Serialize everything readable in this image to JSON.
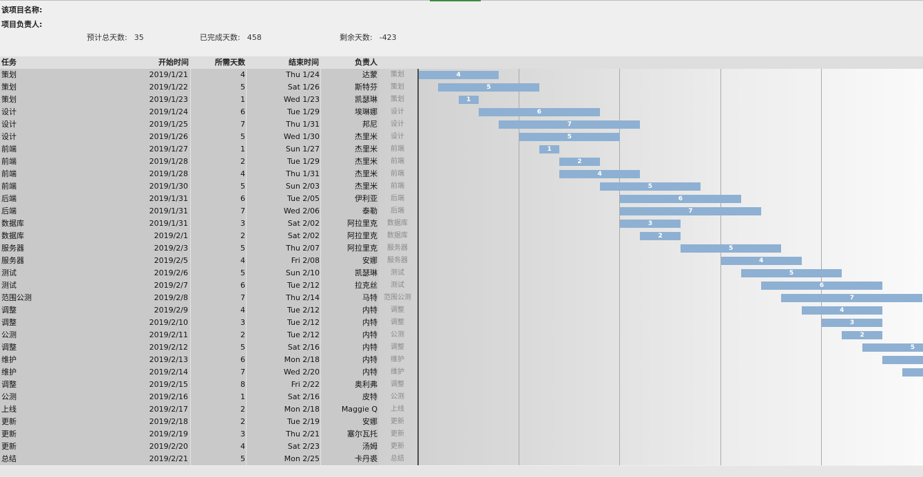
{
  "header": {
    "project_name_label": "该项目名称:",
    "project_owner_label": "项目负责人:",
    "estimated_total_label": "预计总天数:",
    "estimated_total_value": "35",
    "completed_label": "已完成天数:",
    "completed_value": "458",
    "remaining_label": "剩余天数:",
    "remaining_value": "-423"
  },
  "columns": {
    "task": "任务",
    "start": "开始时间",
    "days": "所需天数",
    "end": "结束时间",
    "owner": "负责人"
  },
  "rows": [
    {
      "task": "策划",
      "start": "2019/1/21",
      "days": "4",
      "end": "Thu 1/24",
      "owner": "达蒙",
      "offset": 0
    },
    {
      "task": "策划",
      "start": "2019/1/22",
      "days": "5",
      "end": "Sat 1/26",
      "owner": "斯特芬",
      "offset": 1
    },
    {
      "task": "策划",
      "start": "2019/1/23",
      "days": "1",
      "end": "Wed 1/23",
      "owner": "凯瑟琳",
      "offset": 2
    },
    {
      "task": "设计",
      "start": "2019/1/24",
      "days": "6",
      "end": "Tue 1/29",
      "owner": "埃琳娜",
      "offset": 3
    },
    {
      "task": "设计",
      "start": "2019/1/25",
      "days": "7",
      "end": "Thu 1/31",
      "owner": "邦尼",
      "offset": 4
    },
    {
      "task": "设计",
      "start": "2019/1/26",
      "days": "5",
      "end": "Wed 1/30",
      "owner": "杰里米",
      "offset": 5
    },
    {
      "task": "前端",
      "start": "2019/1/27",
      "days": "1",
      "end": "Sun 1/27",
      "owner": "杰里米",
      "offset": 6
    },
    {
      "task": "前端",
      "start": "2019/1/28",
      "days": "2",
      "end": "Tue 1/29",
      "owner": "杰里米",
      "offset": 7
    },
    {
      "task": "前端",
      "start": "2019/1/28",
      "days": "4",
      "end": "Thu 1/31",
      "owner": "杰里米",
      "offset": 7
    },
    {
      "task": "前端",
      "start": "2019/1/30",
      "days": "5",
      "end": "Sun 2/03",
      "owner": "杰里米",
      "offset": 9
    },
    {
      "task": "后端",
      "start": "2019/1/31",
      "days": "6",
      "end": "Tue 2/05",
      "owner": "伊利亚",
      "offset": 10
    },
    {
      "task": "后端",
      "start": "2019/1/31",
      "days": "7",
      "end": "Wed 2/06",
      "owner": "泰勒",
      "offset": 10
    },
    {
      "task": "数据库",
      "start": "2019/1/31",
      "days": "3",
      "end": "Sat 2/02",
      "owner": "阿拉里克",
      "offset": 10
    },
    {
      "task": "数据库",
      "start": "2019/2/1",
      "days": "2",
      "end": "Sat 2/02",
      "owner": "阿拉里克",
      "offset": 11
    },
    {
      "task": "服务器",
      "start": "2019/2/3",
      "days": "5",
      "end": "Thu 2/07",
      "owner": "阿拉里克",
      "offset": 13
    },
    {
      "task": "服务器",
      "start": "2019/2/5",
      "days": "4",
      "end": "Fri 2/08",
      "owner": "安娜",
      "offset": 15
    },
    {
      "task": "测试",
      "start": "2019/2/6",
      "days": "5",
      "end": "Sun 2/10",
      "owner": "凯瑟琳",
      "offset": 16
    },
    {
      "task": "测试",
      "start": "2019/2/7",
      "days": "6",
      "end": "Tue 2/12",
      "owner": "拉克丝",
      "offset": 17
    },
    {
      "task": "范围公测",
      "start": "2019/2/8",
      "days": "7",
      "end": "Thu 2/14",
      "owner": "马特",
      "offset": 18
    },
    {
      "task": "调整",
      "start": "2019/2/9",
      "days": "4",
      "end": "Tue 2/12",
      "owner": "内特",
      "offset": 19
    },
    {
      "task": "调整",
      "start": "2019/2/10",
      "days": "3",
      "end": "Tue 2/12",
      "owner": "内特",
      "offset": 20
    },
    {
      "task": "公测",
      "start": "2019/2/11",
      "days": "2",
      "end": "Tue 2/12",
      "owner": "内特",
      "offset": 21
    },
    {
      "task": "调整",
      "start": "2019/2/12",
      "days": "5",
      "end": "Sat 2/16",
      "owner": "内特",
      "offset": 22
    },
    {
      "task": "维护",
      "start": "2019/2/13",
      "days": "6",
      "end": "Mon 2/18",
      "owner": "内特",
      "offset": 23
    },
    {
      "task": "维护",
      "start": "2019/2/14",
      "days": "7",
      "end": "Wed 2/20",
      "owner": "内特",
      "offset": 24
    },
    {
      "task": "调整",
      "start": "2019/2/15",
      "days": "8",
      "end": "Fri 2/22",
      "owner": "奥利弗",
      "offset": 25
    },
    {
      "task": "公测",
      "start": "2019/2/16",
      "days": "1",
      "end": "Sat 2/16",
      "owner": "皮特",
      "offset": 26
    },
    {
      "task": "上线",
      "start": "2019/2/17",
      "days": "2",
      "end": "Mon 2/18",
      "owner": "Maggie Q",
      "offset": 27
    },
    {
      "task": "更新",
      "start": "2019/2/18",
      "days": "2",
      "end": "Tue 2/19",
      "owner": "安娜",
      "offset": 28
    },
    {
      "task": "更新",
      "start": "2019/2/19",
      "days": "3",
      "end": "Thu 2/21",
      "owner": "塞尔瓦托",
      "offset": 29
    },
    {
      "task": "更新",
      "start": "2019/2/20",
      "days": "4",
      "end": "Sat 2/23",
      "owner": "汤姆",
      "offset": 30
    },
    {
      "task": "总结",
      "start": "2019/2/21",
      "days": "5",
      "end": "Mon 2/25",
      "owner": "卡丹裘",
      "offset": 31
    }
  ],
  "chart": {
    "bar_color": "#8eb0d2"
  }
}
